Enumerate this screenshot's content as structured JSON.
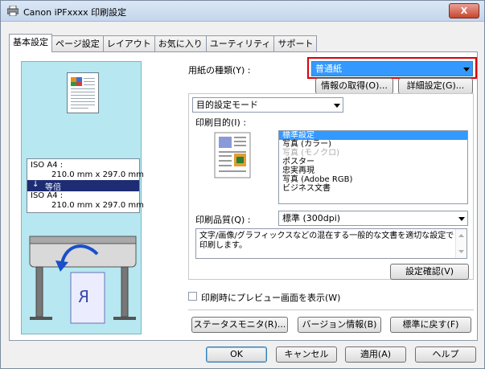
{
  "window": {
    "title": "Canon iPFxxxx 印刷設定",
    "close_label": "X"
  },
  "tabs": [
    {
      "label": "基本設定"
    },
    {
      "label": "ページ設定"
    },
    {
      "label": "レイアウト"
    },
    {
      "label": "お気に入り"
    },
    {
      "label": "ユーティリティ"
    },
    {
      "label": "サポート"
    }
  ],
  "preview": {
    "source_size": "ISO A4 :",
    "source_dim": "210.0 mm x 297.0 mm",
    "magnification": "等倍",
    "output_size": "ISO A4 :",
    "output_dim": "210.0 mm x 297.0 mm"
  },
  "media": {
    "label": "用紙の種類(Y) :",
    "value": "普通紙",
    "get_info_label": "情報の取得(O)...",
    "details_label": "詳細設定(G)..."
  },
  "mode": {
    "value": "目的設定モード"
  },
  "purpose": {
    "label": "印刷目的(I) :",
    "items": [
      {
        "label": "標準設定",
        "state": "selected"
      },
      {
        "label": "写真 (カラー)",
        "state": "normal"
      },
      {
        "label": "写真 (モノクロ)",
        "state": "disabled"
      },
      {
        "label": "ポスター",
        "state": "normal"
      },
      {
        "label": "忠実再現",
        "state": "normal"
      },
      {
        "label": "写真 (Adobe RGB)",
        "state": "normal"
      },
      {
        "label": "ビジネス文書",
        "state": "normal"
      }
    ]
  },
  "quality": {
    "label": "印刷品質(Q) :",
    "value": "標準 (300dpi)"
  },
  "description": "文字/画像/グラフィックスなどの混在する一般的な文書を適切な設定で印刷します。",
  "confirm_label": "設定確認(V)",
  "preview_checkbox_label": "印刷時にプレビュー画面を表示(W)",
  "bottom_buttons": {
    "status_monitor": "ステータスモニタ(R)...",
    "version_info": "バージョン情報(B)",
    "defaults": "標準に戻す(F)"
  },
  "dialog_buttons": {
    "ok": "OK",
    "cancel": "キャンセル",
    "apply": "適用(A)",
    "help": "ヘルプ"
  },
  "colors": {
    "accent_select": "#3399ff",
    "highlight_border": "#d9000a",
    "preview_bg": "#b7e7f0"
  }
}
